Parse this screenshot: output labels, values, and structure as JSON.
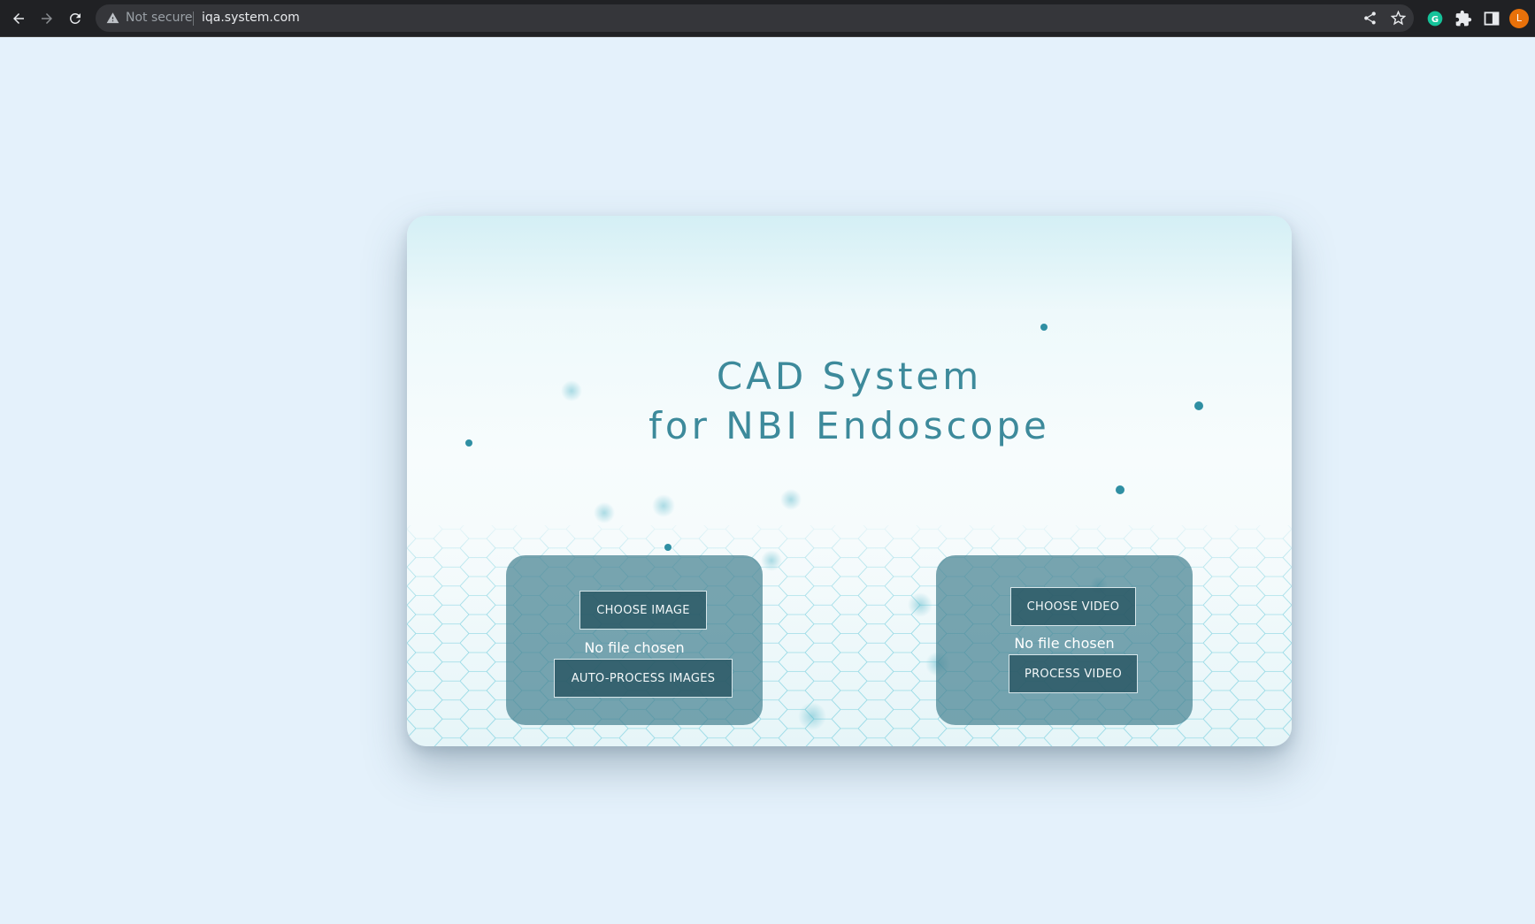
{
  "browser": {
    "security_status": "Not secure",
    "url": "iqa.system.com",
    "profile_initial": "L",
    "icons": [
      "back-icon",
      "forward-icon",
      "reload-icon",
      "warning-icon",
      "share-icon",
      "star-icon",
      "grammarly-icon",
      "extensions-icon",
      "side-panel-icon"
    ]
  },
  "page": {
    "title_line1": "CAD System",
    "title_line2": "for NBI Endoscope",
    "image_panel": {
      "choose_label": "CHOOSE IMAGE",
      "file_status": "No file chosen",
      "process_label": "AUTO-PROCESS IMAGES"
    },
    "video_panel": {
      "choose_label": "CHOOSE VIDEO",
      "file_status": "No file chosen",
      "process_label": "PROCESS VIDEO"
    }
  },
  "colors": {
    "page_background": "#e4f1fb",
    "title": "#3d8a9b",
    "panel": "#46828f",
    "button": "#285562"
  }
}
